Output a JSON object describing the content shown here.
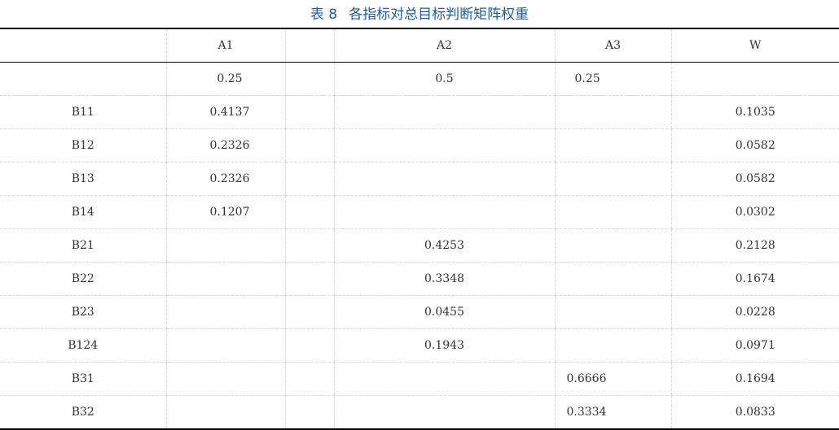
{
  "caption": {
    "number": "表 8",
    "title": "各指标对总目标判断矩阵权重"
  },
  "columns": [
    "",
    "A1",
    "",
    "A2",
    "A3",
    "W"
  ],
  "weights_row": {
    "label": "",
    "a1": "0.25",
    "a2": "0.5",
    "a3": "0.25",
    "w": ""
  },
  "rows": [
    {
      "label": "B11",
      "a1": "0.4137",
      "a2": "",
      "a3": "",
      "w": "0.1035"
    },
    {
      "label": "B12",
      "a1": "0.2326",
      "a2": "",
      "a3": "",
      "w": "0.0582"
    },
    {
      "label": "B13",
      "a1": "0.2326",
      "a2": "",
      "a3": "",
      "w": "0.0582"
    },
    {
      "label": "B14",
      "a1": "0.1207",
      "a2": "",
      "a3": "",
      "w": "0.0302"
    },
    {
      "label": "B21",
      "a1": "",
      "a2": "0.4253",
      "a3": "",
      "w": "0.2128"
    },
    {
      "label": "B22",
      "a1": "",
      "a2": "0.3348",
      "a3": "",
      "w": "0.1674"
    },
    {
      "label": "B23",
      "a1": "",
      "a2": "0.0455",
      "a3": "",
      "w": "0.0228"
    },
    {
      "label": "B124",
      "a1": "",
      "a2": "0.1943",
      "a3": "",
      "w": "0.0971"
    },
    {
      "label": "B31",
      "a1": "",
      "a2": "",
      "a3": "0.6666",
      "w": "0.1694"
    },
    {
      "label": "B32",
      "a1": "",
      "a2": "",
      "a3": "0.3334",
      "w": "0.0833"
    }
  ]
}
